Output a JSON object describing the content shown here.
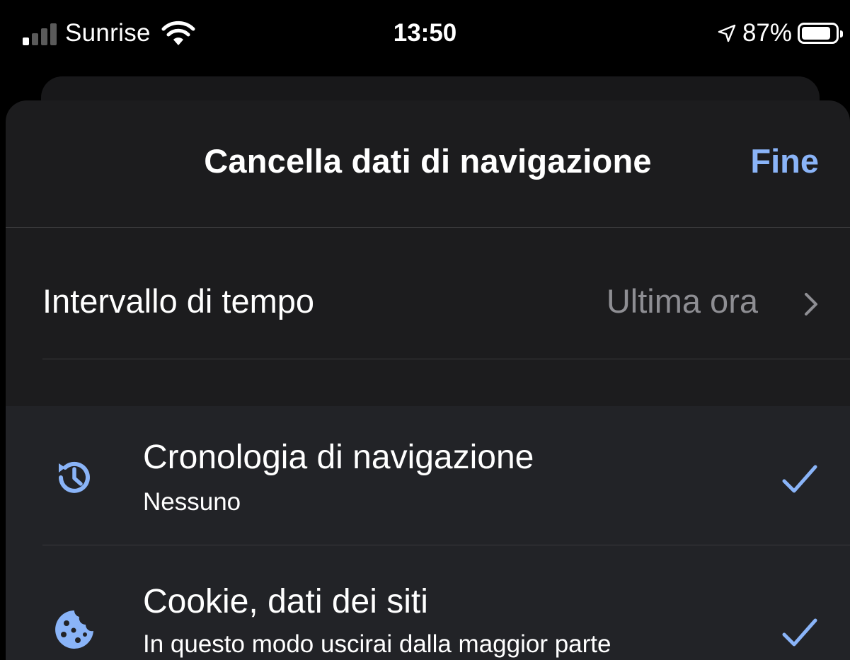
{
  "status_bar": {
    "carrier": "Sunrise",
    "time": "13:50",
    "battery_percent": "87%",
    "battery_level": 0.87,
    "signal_bars_on": 1,
    "signal_bars_total": 4,
    "icons": [
      "signal-icon",
      "wifi-icon",
      "location-arrow-icon",
      "battery-icon"
    ]
  },
  "header": {
    "title": "Cancella dati di navigazione",
    "done_label": "Fine"
  },
  "time_range": {
    "label": "Intervallo di tempo",
    "value": "Ultima ora",
    "icon": "chevron-right-icon"
  },
  "data_types": [
    {
      "title": "Cronologia di navigazione",
      "subtitle": "Nessuno",
      "checked": true,
      "icon": "history-icon"
    },
    {
      "title": "Cookie, dati dei siti",
      "subtitle": "In questo modo uscirai dalla maggior parte",
      "checked": true,
      "icon": "cookie-icon"
    }
  ],
  "colors": {
    "accent": "#8ab4f8",
    "sheet_background": "#1c1c1e",
    "list_background": "#222327",
    "secondary_text": "#8e8e93",
    "divider": "#3a3a3c"
  }
}
